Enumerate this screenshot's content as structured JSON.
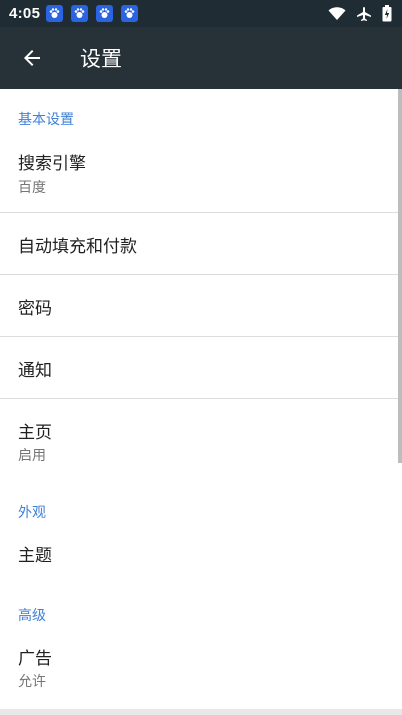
{
  "status_bar": {
    "time": "4:05",
    "notification_icons": [
      "baidu-paw-icon",
      "baidu-paw-icon",
      "baidu-paw-icon",
      "baidu-paw-icon"
    ],
    "right_icons": [
      "wifi-icon",
      "airplane-icon",
      "battery-icon"
    ]
  },
  "toolbar": {
    "title": "设置",
    "back_icon": "arrow-left-icon"
  },
  "sections": {
    "basic": {
      "header": "基本设置",
      "search_engine": {
        "title": "搜索引擎",
        "subtitle": "百度"
      },
      "autofill": {
        "title": "自动填充和付款"
      },
      "passwords": {
        "title": "密码"
      },
      "notifications": {
        "title": "通知"
      },
      "homepage": {
        "title": "主页",
        "subtitle": "启用"
      }
    },
    "appearance": {
      "header": "外观",
      "theme": {
        "title": "主题"
      }
    },
    "advanced": {
      "header": "高级",
      "ads": {
        "title": "广告",
        "subtitle": "允许"
      }
    }
  },
  "colors": {
    "status_bar": "#1f2c34",
    "toolbar": "#263238",
    "section_header": "#3f7fd6",
    "primary_text": "#212121",
    "secondary_text": "#757575"
  }
}
